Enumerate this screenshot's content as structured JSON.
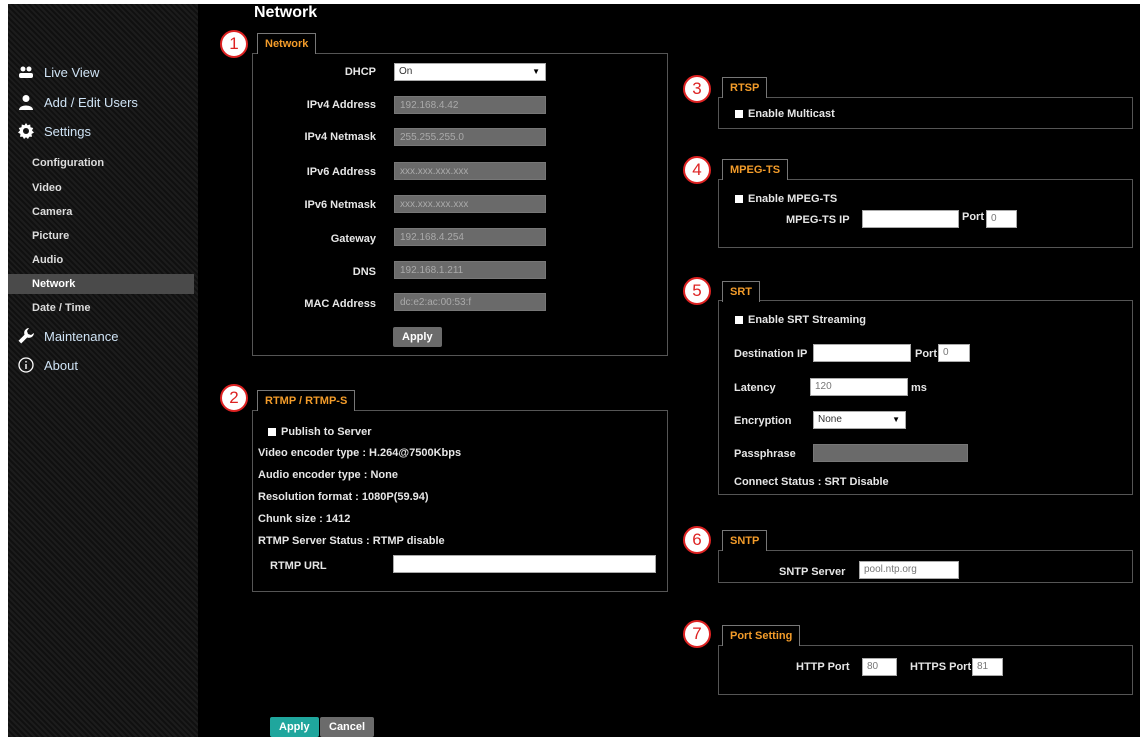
{
  "page_title": "Network",
  "sidebar": {
    "live_view": "Live View",
    "add_edit_users": "Add / Edit Users",
    "settings": "Settings",
    "sub": [
      "Configuration",
      "Video",
      "Camera",
      "Picture",
      "Audio",
      "Network",
      "Date / Time"
    ],
    "active": "Network",
    "maintenance": "Maintenance",
    "about": "About"
  },
  "badges": [
    "1",
    "2",
    "3",
    "4",
    "5",
    "6",
    "7"
  ],
  "network": {
    "tab": "Network",
    "dhcp_label": "DHCP",
    "dhcp_value": "On",
    "ipv4_address_label": "IPv4 Address",
    "ipv4_address": "192.168.4.42",
    "ipv4_netmask_label": "IPv4 Netmask",
    "ipv4_netmask": "255.255.255.0",
    "ipv6_address_label": "IPv6 Address",
    "ipv6_address": "xxx.xxx.xxx.xxx",
    "ipv6_netmask_label": "IPv6 Netmask",
    "ipv6_netmask": "xxx.xxx.xxx.xxx",
    "gateway_label": "Gateway",
    "gateway": "192.168.4.254",
    "dns_label": "DNS",
    "dns": "192.168.1.211",
    "mac_label": "MAC Address",
    "mac": "dc:e2:ac:00:53:f",
    "apply": "Apply"
  },
  "rtmp": {
    "tab": "RTMP / RTMP-S",
    "publish": "Publish to Server",
    "video_encoder": "Video encoder type : H.264@7500Kbps",
    "audio_encoder": "Audio encoder type : None",
    "resolution": "Resolution format : 1080P(59.94)",
    "chunk": "Chunk size : 1412",
    "status": "RTMP Server Status : RTMP disable",
    "url_label": "RTMP URL",
    "url_value": ""
  },
  "rtsp": {
    "tab": "RTSP",
    "multicast": "Enable Multicast"
  },
  "mpegts": {
    "tab": "MPEG-TS",
    "enable": "Enable MPEG-TS",
    "ip_label": "MPEG-TS IP",
    "ip_value": "",
    "port_label": "Port",
    "port_value": "0"
  },
  "srt": {
    "tab": "SRT",
    "enable": "Enable SRT Streaming",
    "dest_label": "Destination IP",
    "dest_value": "",
    "port_label": "Port",
    "port_value": "0",
    "latency_label": "Latency",
    "latency_value": "120",
    "latency_unit": "ms",
    "encryption_label": "Encryption",
    "encryption_value": "None",
    "passphrase_label": "Passphrase",
    "passphrase_value": "",
    "connect_status": "Connect Status : SRT Disable"
  },
  "sntp": {
    "tab": "SNTP",
    "server_label": "SNTP Server",
    "server_value": "pool.ntp.org"
  },
  "port_setting": {
    "tab": "Port Setting",
    "http_label": "HTTP Port",
    "http_value": "80",
    "https_label": "HTTPS Port",
    "https_value": "81"
  },
  "footer": {
    "apply": "Apply",
    "cancel": "Cancel"
  }
}
